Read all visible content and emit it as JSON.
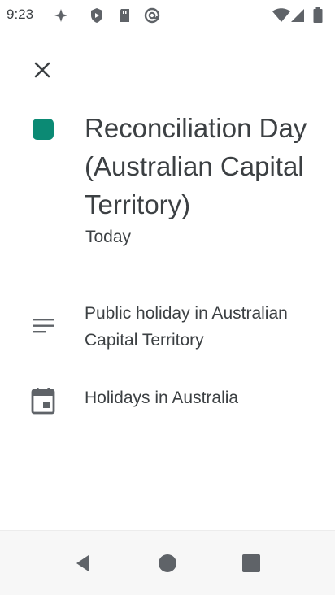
{
  "status_bar": {
    "time": "9:23"
  },
  "header": {
    "close_icon": "close-icon"
  },
  "event": {
    "title": "Reconciliation Day (Australian Capital Territory)",
    "date": "Today",
    "color": "#0b8a74",
    "description": "Public holiday in Australian Capital Territory",
    "calendar": "Holidays in Australia"
  },
  "nav": {
    "back": "back-icon",
    "home": "home-icon",
    "recents": "recents-icon"
  }
}
